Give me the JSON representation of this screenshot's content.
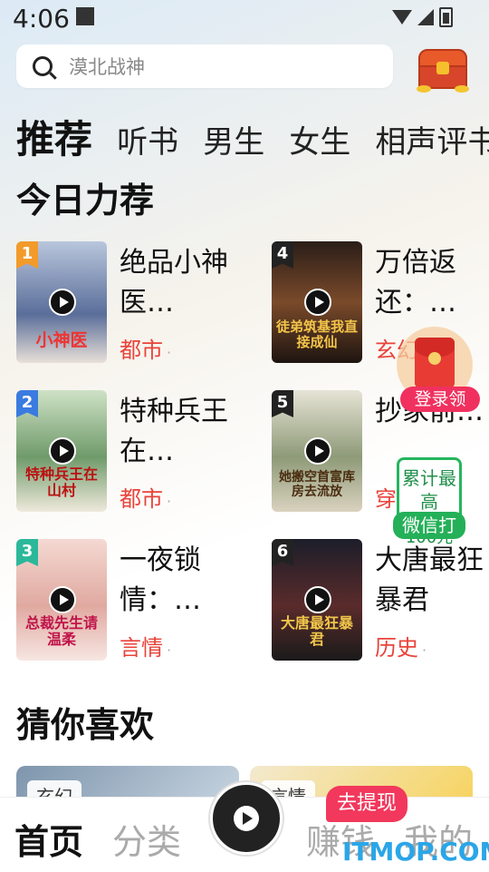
{
  "status": {
    "time": "4:06"
  },
  "search": {
    "placeholder": "漠北战神"
  },
  "tabs": [
    {
      "label": "推荐",
      "active": true
    },
    {
      "label": "听书"
    },
    {
      "label": "男生"
    },
    {
      "label": "女生"
    },
    {
      "label": "相声评书"
    }
  ],
  "recommend": {
    "title": "今日力荐",
    "items": [
      {
        "rank": "1",
        "name": "绝品小神医…",
        "genre": "都市",
        "cover_text": "小神医"
      },
      {
        "rank": "4",
        "name": "万倍返还：…",
        "genre": "玄幻",
        "cover_text": "徒弟筑基我直接成仙"
      },
      {
        "rank": "2",
        "name": "特种兵王在…",
        "genre": "都市",
        "cover_text": "特种兵王在山村"
      },
      {
        "rank": "5",
        "name": "抄家前…",
        "genre": "穿越",
        "cover_text": "她搬空首富库房去流放"
      },
      {
        "rank": "3",
        "name": "一夜锁情：…",
        "genre": "言情",
        "cover_text": "总裁先生请温柔"
      },
      {
        "rank": "6",
        "name": "大唐最狂暴君",
        "genre": "历史",
        "cover_text": "大唐最狂暴君"
      }
    ]
  },
  "float_redpacket": {
    "label": "登录领"
  },
  "float_wechat": {
    "line1": "累计最高",
    "amount": "100元",
    "label": "微信打"
  },
  "guess": {
    "title": "猜你喜欢",
    "cards": [
      {
        "tag": "玄幻"
      },
      {
        "tag": "言情"
      }
    ]
  },
  "bottom_nav": {
    "items": [
      {
        "label": "首页",
        "active": true
      },
      {
        "label": "分类"
      },
      {
        "label": "赚钱"
      },
      {
        "label": "我的"
      }
    ],
    "withdraw_label": "去提现"
  },
  "watermark": "ITMOP.COM",
  "colors": {
    "accent_red": "#e8433a",
    "badge_pink": "#f0315f",
    "wechat_green": "#24b058"
  }
}
